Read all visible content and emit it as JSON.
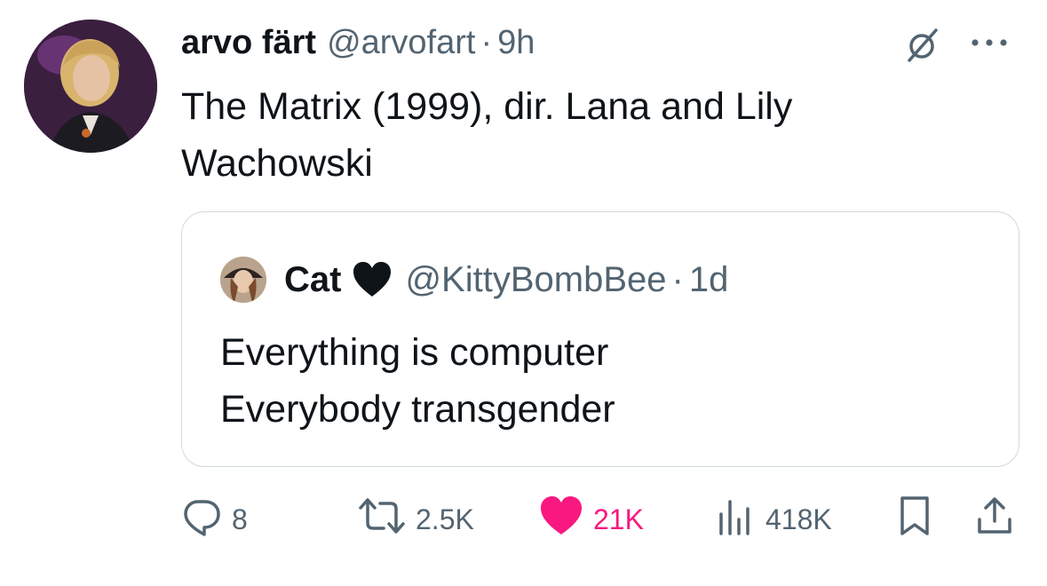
{
  "tweet": {
    "author_name": "arvo färt",
    "author_handle": "@arvofart",
    "separator": "·",
    "time": "9h",
    "text": "The Matrix (1999), dir. Lana and Lily Wachowski"
  },
  "quoted_tweet": {
    "author_name": "Cat",
    "author_emoji": "black-heart",
    "author_handle": "@KittyBombBee",
    "separator": "·",
    "time": "1d",
    "lines": [
      "Everything is computer",
      "Everybody transgender"
    ]
  },
  "actions": {
    "replies": "8",
    "reposts": "2.5K",
    "likes": "21K",
    "views": "418K"
  },
  "colors": {
    "text_primary": "#0f1419",
    "text_secondary": "#536471",
    "like_pink": "#f91880",
    "border": "#cfd9de"
  },
  "icons": [
    "grok-icon",
    "more-icon",
    "reply-icon",
    "repost-icon",
    "like-icon",
    "views-icon",
    "bookmark-icon",
    "share-icon"
  ]
}
